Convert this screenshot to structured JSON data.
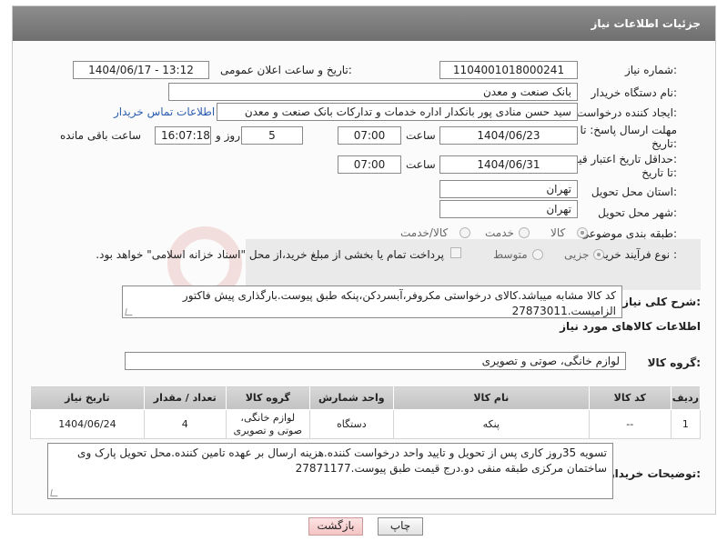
{
  "panel": {
    "title": "جزئیات اطلاعات نیاز"
  },
  "fields": {
    "need_number": {
      "label": "شماره نیاز:",
      "value": "1104001018000241"
    },
    "announce": {
      "label": "تاریخ و ساعت اعلان عمومی:",
      "value": "1404/06/17 - 13:12"
    },
    "buyer_org": {
      "label": "نام دستگاه خریدار:",
      "value": "بانک صنعت و معدن"
    },
    "creator": {
      "label": "ایجاد کننده درخواست:",
      "value": "سید حسن منادی پور بانکدار اداره خدمات و تدارکات بانک صنعت و معدن",
      "contact_link": "اطلاعات تماس خریدار"
    },
    "reply_deadline": {
      "label_line1": "مهلت ارسال پاسخ: تا",
      "label_line2": "تاریخ:",
      "date": "1404/06/23",
      "time_label": "ساعت",
      "time": "07:00",
      "days": "5",
      "days_label": "روز و",
      "remaining": "16:07:18",
      "remaining_label": "ساعت باقی مانده"
    },
    "price_validity": {
      "label_line1": "حداقل تاریخ اعتبار قیمت:",
      "label_line2": "تا تاریخ:",
      "date": "1404/06/31",
      "time_label": "ساعت",
      "time": "07:00"
    },
    "province": {
      "label": "استان محل تحویل:",
      "value": "تهران"
    },
    "city": {
      "label": "شهر محل تحویل:",
      "value": "تهران"
    },
    "category": {
      "label": "طبقه بندی موضوعی:",
      "options": [
        "کالا",
        "خدمت",
        "کالا/خدمت"
      ],
      "selected": "کالا"
    },
    "process": {
      "label": "نوع فرآیند خرید :",
      "options": [
        "جزیی",
        "متوسط"
      ],
      "selected": "جزیی",
      "payment_note": "پرداخت تمام یا بخشی از مبلغ خرید،از محل \"اسناد خزانه اسلامی\" خواهد بود."
    }
  },
  "description": {
    "label": "شرح کلی نیاز:",
    "value": "کد کالا مشابه میباشد.کالای درخواستی مکروفر،آبسردکن،پنکه طبق پیوست.بارگذاری پیش فاکتور الزامیست.27873011"
  },
  "goods_section": {
    "title": "اطلاعات کالاهای مورد نیاز",
    "group_label": "گروه کالا:",
    "group_value": "لوازم خانگی، صوتی و تصویری"
  },
  "table": {
    "headers": [
      "ردیف",
      "کد کالا",
      "نام کالا",
      "واحد شمارش",
      "گروه کالا",
      "تعداد / مقدار",
      "تاریخ نیاز"
    ],
    "rows": [
      [
        "1",
        "--",
        "پنکه",
        "دستگاه",
        "لوازم خانگی، صوتی و تصویری",
        "4",
        "1404/06/24"
      ]
    ]
  },
  "buyer_notes": {
    "label": "توضیحات خریدار:",
    "value": "تسویه 35روز کاری پس از تحویل و تایید واحد درخواست کننده.هزینه ارسال بر عهده تامین کننده.محل تحویل پارک وی ساختمان مرکزی طبقه منفی دو.درج قیمت طبق پیوست.27871177"
  },
  "buttons": {
    "print": "چاپ",
    "back": "بازگشت"
  },
  "colors": {
    "header": "#7a7a7a",
    "link": "#2a5db0",
    "back_button": "#f4c4c4"
  }
}
